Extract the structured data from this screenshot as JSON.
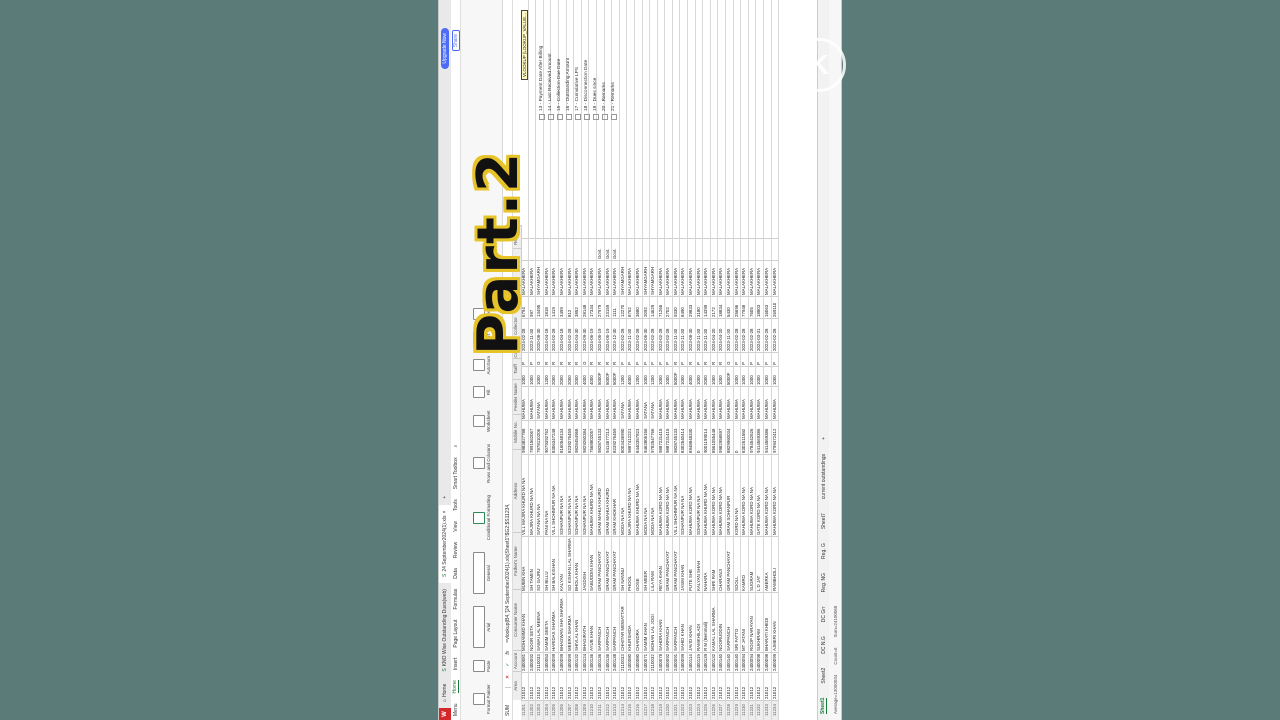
{
  "window": {
    "tabs": [
      {
        "label": "Home"
      },
      {
        "label": "KNO Wise Outstanding Dues(web)"
      },
      {
        "label": "24 September2024(1).xls"
      }
    ],
    "upgrade_label": "Upgrade Now",
    "share_label": "Share"
  },
  "menu": {
    "items": [
      "Menu",
      "Home",
      "Insert",
      "Page Layout",
      "Formulas",
      "Data",
      "Review",
      "View",
      "Tools",
      "Smart Toolbox"
    ]
  },
  "ribbon": {
    "groups": [
      "Format Painter",
      "Paste",
      "Arial",
      "General",
      "Conditional Formatting",
      "Rows and Columns",
      "Worksheet",
      "Fill",
      "AutoSum",
      "Sort",
      "Filter"
    ]
  },
  "formula_bar": {
    "name_box": "SUM",
    "formula": "=vlookup(B4,'[24 September2024(1).xls]Sheet1'!$G2:$S11234,"
  },
  "columns": [
    "Area",
    "Account",
    "Consumer Name",
    "Father's Name",
    "Address",
    "Mobile No.",
    "Feeder Name",
    "Tariff",
    "Conne",
    "Collector",
    "Outstanding",
    "JEN",
    "Remark"
  ],
  "rows": [
    {
      "n": "11201",
      "area": "21012",
      "acc": "2400081",
      "name": "MOHAMMD KHAN",
      "father": "MUBIN KHA",
      "addr": "VILL MAJIRA KHURD NA NA",
      "mob": "9983827788",
      "feeder": "MAHUWA",
      "tariff": "1000",
      "conn": "P",
      "date": "2024-02-28",
      "out": "6794",
      "jen": "MALAKHERA",
      "rem": ""
    },
    {
      "n": "11202",
      "area": "21012",
      "acc": "2400092",
      "name": "NOOR SETA",
      "father": "SH TAMIIN",
      "addr": "MAJIRA KHURD NA NA",
      "mob": "7891562067",
      "feeder": "MAHUWA",
      "tariff": "1000",
      "conn": "P",
      "date": "2023-11-30",
      "out": "997",
      "jen": "MALAKHERA",
      "rem": ""
    },
    {
      "n": "11203",
      "area": "21012",
      "acc": "2110033",
      "name": "SAWAI LAL MEENA",
      "father": "SO GAJRU",
      "addr": "SATANA NA NA",
      "mob": "7878110206",
      "feeder": "SATANA",
      "tariff": "1000",
      "conn": "O",
      "date": "2020-08-30",
      "out": "13495",
      "jen": "SHYAMGARH",
      "rem": ""
    },
    {
      "n": "11204",
      "area": "21012",
      "acc": "2400053",
      "name": "SAMIM GEETA",
      "father": "SH BILLU",
      "addr": "PANI NA NA",
      "mob": "9079392762",
      "feeder": "MAHUWA",
      "tariff": "1200",
      "conn": "R",
      "date": "2024-04-18",
      "out": "1818",
      "jen": "MALAKHERA",
      "rem": ""
    },
    {
      "n": "11205",
      "area": "21012",
      "acc": "2400099",
      "name": "HARIDAS SHARMA",
      "father": "SH BALKISHAN",
      "addr": "VILL SHOHNPUR NA NA",
      "mob": "8306347248",
      "feeder": "MAHUWA",
      "tariff": "2000",
      "conn": "R",
      "date": "2024-02-28",
      "out": "1419",
      "jen": "MALAKHERA",
      "rem": ""
    },
    {
      "n": "11206",
      "area": "21012",
      "acc": "2400099",
      "name": "BHAGWAN SHA SHARMA",
      "father": "KALYAN",
      "addr": "SOHANPUR NA NA",
      "mob": "8160548134",
      "feeder": "MAHUWA",
      "tariff": "2000",
      "conn": "R",
      "date": "2024-04-18",
      "out": "3499",
      "jen": "MALAKHERA",
      "rem": ""
    },
    {
      "n": "11207",
      "area": "21012",
      "acc": "2400099",
      "name": "MEERA SHARMA",
      "father": "SO KISHAN LAL SHARMA",
      "addr": "SOHANPUR NA NA",
      "mob": "8239276459",
      "feeder": "MAHUWA",
      "tariff": "2000",
      "conn": "R",
      "date": "2024-02-28",
      "out": "812",
      "jen": "MALAKHERA",
      "rem": ""
    },
    {
      "n": "11208",
      "area": "21012",
      "acc": "2400132",
      "name": "SHIVLAL KHAN",
      "father": "BHOLA KHAN",
      "addr": "SOHANPUR NA NA",
      "mob": "9828454968",
      "feeder": "MAHUWA",
      "tariff": "2000",
      "conn": "R",
      "date": "2024-04-30",
      "out": "3852",
      "jen": "MALAKHERA",
      "rem": ""
    },
    {
      "n": "11209",
      "area": "21012",
      "acc": "2400124",
      "name": "BHAGIRATH",
      "father": "JAGDISH",
      "addr": "SOHANPUR NA NA",
      "mob": "9829260384",
      "feeder": "MAHUWA",
      "tariff": "4000",
      "conn": "O",
      "date": "2023-09-30",
      "out": "28148",
      "jen": "MALAKHERA",
      "rem": ""
    },
    {
      "n": "11210",
      "area": "21012",
      "acc": "2400136",
      "name": "AYUB KHAN",
      "father": "SABUDDIN KHAN",
      "addr": "MAHUWA KHURD NA NA",
      "mob": "7568802057",
      "feeder": "MAHUWA",
      "tariff": "4000",
      "conn": "R",
      "date": "2024-06-19",
      "out": "17334",
      "jen": "MALAKHERA",
      "rem": ""
    },
    {
      "n": "11211",
      "area": "21012",
      "acc": "2400136",
      "name": "SARPANCH",
      "father": "GRAM PANCHAYAT",
      "addr": "GRAM MAHUA KHURD",
      "mob": "9828745133",
      "feeder": "MAHUWA",
      "tariff": "5000F",
      "conn": "R",
      "date": "2024-06-19",
      "out": "27979",
      "jen": "MALAKHERA",
      "rem": "Govt."
    },
    {
      "n": "11212",
      "area": "21012",
      "acc": "2400136",
      "name": "SARPANCH",
      "father": "GRAM PANCHAYAT",
      "addr": "GRAM MAHUA KHURD",
      "mob": "9414677213",
      "feeder": "MAHUWA",
      "tariff": "5000F",
      "conn": "R",
      "date": "2024-06-19",
      "out": "23159",
      "jen": "MALAKHERA",
      "rem": "Govt."
    },
    {
      "n": "11213",
      "area": "21012",
      "acc": "2400138",
      "name": "SARPANCH",
      "father": "GRAM PANCHAYAT",
      "addr": "GRAM KHOKHAR",
      "mob": "8239276459",
      "feeder": "MAHUWA",
      "tariff": "5000F",
      "conn": "R",
      "date": "2023-12-30",
      "out": "1111",
      "jen": "MALAKHERA",
      "rem": "Govt."
    },
    {
      "n": "11214",
      "area": "21012",
      "acc": "2110033",
      "name": "CHHITAR MEWATTAR",
      "father": "SH NANNU",
      "addr": "MODA NA NA",
      "mob": "8003436990",
      "feeder": "SATANA",
      "tariff": "1200",
      "conn": "P",
      "date": "2022-02-28",
      "out": "12270",
      "jen": "SHYAMGARH",
      "rem": ""
    },
    {
      "n": "11215",
      "area": "21012",
      "acc": "2400080",
      "name": "KHURSHIDA",
      "father": "PHOOL",
      "addr": "MAJIRA KHURD NA NA",
      "mob": "9887412221",
      "feeder": "MAHUWA",
      "tariff": "4000",
      "conn": "P",
      "date": "2023-11-30",
      "out": "8762",
      "jen": "MALAKHERA",
      "rem": ""
    },
    {
      "n": "11216",
      "area": "21012",
      "acc": "2400080",
      "name": "CHANDRA",
      "father": "GOSE",
      "addr": "MAHUWA KHURD NA NA",
      "mob": "8440357823",
      "feeder": "MAHUWA",
      "tariff": "1200",
      "conn": "P",
      "date": "2023-02-28",
      "out": "3680",
      "jen": "MALAKHERA",
      "rem": ""
    },
    {
      "n": "11217",
      "area": "21012",
      "acc": "2400071",
      "name": "SAMIM KHAN",
      "father": "SH MEER",
      "addr": "MODA NA NA",
      "mob": "9462806156",
      "feeder": "SATANA",
      "tariff": "1000",
      "conn": "P",
      "date": "2023-06-30",
      "out": "2092",
      "jen": "SHYAMGARH",
      "rem": ""
    },
    {
      "n": "11218",
      "area": "21012",
      "acc": "2110032",
      "name": "MOHAN LAL JOGI",
      "father": "LILA RAM",
      "addr": "MODA NA NA",
      "mob": "9782547766",
      "feeder": "SATANA",
      "tariff": "1200",
      "conn": "P",
      "date": "2023-02-28",
      "out": "14629",
      "jen": "SHYAMGARH",
      "rem": ""
    },
    {
      "n": "11219",
      "area": "21012",
      "acc": "2400078",
      "name": "SAHDRA KHAN",
      "father": "REYA KHAN",
      "addr": "MAHUWA KORD NA NA",
      "mob": "9887231415",
      "feeder": "MAHUWA",
      "tariff": "1000",
      "conn": "P",
      "date": "2023-02-28",
      "out": "71265",
      "jen": "MALAKHERA",
      "rem": ""
    },
    {
      "n": "11220",
      "area": "21012",
      "acc": "2400092",
      "name": "SARPANCH",
      "father": "GRAM PANCHAYAT",
      "addr": "MAHUWA KORD NA NA",
      "mob": "9887231415",
      "feeder": "MAHUWA",
      "tariff": "1000",
      "conn": "P",
      "date": "2023-02-28",
      "out": "2702",
      "jen": "MALAKHERA",
      "rem": ""
    },
    {
      "n": "11221",
      "area": "21012",
      "acc": "2400091",
      "name": "SARPANCH",
      "father": "GRAM PANCHAYAT",
      "addr": "VILL SHOHNPUR NA NA",
      "mob": "9828745133",
      "feeder": "MAHUWA",
      "tariff": "5000F",
      "conn": "R",
      "date": "2023-11-30",
      "out": "9330",
      "jen": "MALAKHERA",
      "rem": ""
    },
    {
      "n": "11222",
      "area": "21012",
      "acc": "2400099",
      "name": "SAHID KHAN",
      "father": "JASIM KHAN",
      "addr": "SOHANPUR NA NA",
      "mob": "8302540414",
      "feeder": "MAHUWA",
      "tariff": "1000",
      "conn": "P",
      "date": "2023-11-30",
      "out": "8490",
      "jen": "MALAKHERA",
      "rem": ""
    },
    {
      "n": "11223",
      "area": "21012",
      "acc": "2400114",
      "name": "JAVID KHAN",
      "father": "PUTE SHE",
      "addr": "MAHUWA KORD NA NA",
      "mob": "8948848330",
      "feeder": "MAHUWA",
      "tariff": "4000",
      "conn": "R",
      "date": "2023-08-30",
      "out": "29833",
      "jen": "MALAKHERA",
      "rem": ""
    },
    {
      "n": "11224",
      "area": "21012",
      "acc": "2400119",
      "name": "RAMKHILADI",
      "father": "KALYAN SHAH",
      "addr": "SOHANPUR NA NA",
      "mob": "0",
      "feeder": "MAHUWA",
      "tariff": "1000",
      "conn": "P",
      "date": "2023-11-30",
      "out": "3180",
      "jen": "MALAKHERA",
      "rem": ""
    },
    {
      "n": "11225",
      "area": "21012",
      "acc": "2400139",
      "name": "R M (Bemmali)",
      "father": "NAHARA",
      "addr": "MAHUWA KHURD NA NA",
      "mob": "9001199014",
      "feeder": "MAHUWA",
      "tariff": "2000",
      "conn": "R",
      "date": "2023-11-30",
      "out": "14399",
      "jen": "MALAKHERA",
      "rem": ""
    },
    {
      "n": "11226",
      "area": "21012",
      "acc": "2400132",
      "name": "KAMAL LAL SHARMA",
      "father": "SHRI RAM",
      "addr": "MAHUWA KORD NA NA",
      "mob": "8561055448",
      "feeder": "MAHUWA",
      "tariff": "1000",
      "conn": "R",
      "date": "2024-04-20",
      "out": "2172",
      "jen": "MALAKHERA",
      "rem": ""
    },
    {
      "n": "11227",
      "area": "21012",
      "acc": "2400140",
      "name": "NOORUDDIN",
      "father": "CHARANJI",
      "addr": "MAHUWA KORD NA NA",
      "mob": "9982958597",
      "feeder": "MAHUWA",
      "tariff": "1000",
      "conn": "R",
      "date": "2024-04-20",
      "out": "18834",
      "jen": "MALAKHERA",
      "rem": ""
    },
    {
      "n": "11228",
      "area": "21012",
      "acc": "2400140",
      "name": "SARPANCH",
      "father": "GRAM PANCHAYAT",
      "addr": "GRAM SOHANPUR",
      "mob": "8829960034",
      "feeder": "MAHUWA",
      "tariff": "5000F",
      "conn": "O",
      "date": "2023-11-30",
      "out": "5430",
      "jen": "MALAKHERA",
      "rem": ""
    },
    {
      "n": "11229",
      "area": "21012",
      "acc": "2400140",
      "name": "SRI FATTO",
      "father": "SOOLL",
      "addr": "KORD NA NA",
      "mob": "0",
      "feeder": "MAHUWA",
      "tariff": "1000",
      "conn": "P",
      "date": "2023-02-28",
      "out": "25696",
      "jen": "MALAKHERA",
      "rem": ""
    },
    {
      "n": "11230",
      "area": "21012",
      "acc": "2400094",
      "name": "MT JATANI",
      "father": "KAMRO",
      "addr": "MAHUWA KORD NA NA",
      "mob": "8302511560",
      "feeder": "MAHUWA",
      "tariff": "1000",
      "conn": "P",
      "date": "2023-02-28",
      "out": "77948",
      "jen": "MALAKHERA",
      "rem": ""
    },
    {
      "n": "11231",
      "area": "21012",
      "acc": "2400094",
      "name": "ROOP NARAYAN",
      "father": "SUGRAM",
      "addr": "MAHUWA KORD NA NA",
      "mob": "9784542626",
      "feeder": "MAHUWA",
      "tariff": "1000",
      "conn": "P",
      "date": "2023-02-28",
      "out": "7605",
      "jen": "MALAKHERA",
      "rem": ""
    },
    {
      "n": "11232",
      "area": "21012",
      "acc": "2400098",
      "name": "SUKHRAM",
      "father": "L D JAT",
      "addr": "GATE KORD NA NA",
      "mob": "9414569386",
      "feeder": "MAHUWA",
      "tariff": "1000",
      "conn": "P",
      "date": "2024-03-31",
      "out": "18803",
      "jen": "MALAKHERA",
      "rem": ""
    },
    {
      "n": "11233",
      "area": "21012",
      "acc": "2400098",
      "name": "BHARATI KHEDI",
      "father": "AMERKA",
      "addr": "MAHUWA KORD NA NA",
      "mob": "9414569386",
      "feeder": "MAHUWA",
      "tariff": "1000",
      "conn": "P",
      "date": "2023-02-28",
      "out": "16063",
      "jen": "MALAKHERA",
      "rem": ""
    },
    {
      "n": "11234",
      "area": "21012",
      "acc": "2400099",
      "name": "AJMERI KHAN",
      "father": "RAMBHOLI",
      "addr": "MAHUWA KORD NA NA",
      "mob": "9799472412",
      "feeder": "MAHUWA",
      "tariff": "1000",
      "conn": "P",
      "date": "2023-02-28",
      "out": "269110",
      "jen": "MALAKHERA",
      "rem": ""
    }
  ],
  "side_fields": [
    "13 - Payment Date After Billing",
    "14 - Last Received Amount",
    "15 - Collection Due Date",
    "16 - Outstanding Amount",
    "17 - Cumulative LPS",
    "18 - Disconnection Date",
    "19 - Dues since",
    "20 - Remarks",
    "21 - Remarks"
  ],
  "side_tooltip": "VLOOKUP (LOOKUP_VALUE...",
  "sheet_tabs": [
    "Sheet1",
    "Sheet2",
    "DC N.G",
    "DC Grr",
    "Reg. NG",
    "Reg. G",
    "Sheet7",
    "current outstandings"
  ],
  "status": {
    "average": "Average=13050034",
    "count": "Count=6",
    "sum": "Sum=24100068"
  },
  "overlay_text": "Part.2",
  "watermark_letter": "K"
}
